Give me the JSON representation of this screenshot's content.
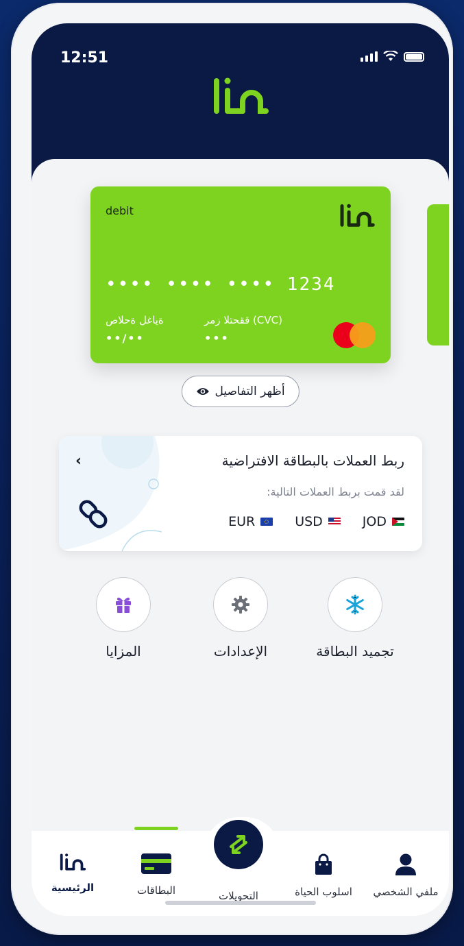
{
  "status": {
    "time": "12:51"
  },
  "brand": {
    "accent": "#7ed321",
    "navy": "#0b1a45"
  },
  "card": {
    "type": "debit",
    "masked_number": "•••• •••• •••• 1234",
    "expiry_label": "ةياغل ةحلاص",
    "expiry_value": "••/••",
    "cvc_label": "ققحتلا زمر (CVC)",
    "cvc_value": "•••",
    "network_icon": "mastercard-icon"
  },
  "show_details": {
    "label": "أظهر التفاصيل",
    "icon": "eye-icon"
  },
  "currency_link": {
    "title": "ربط العملات بالبطاقة الافتراضية",
    "subtitle": "لقد قمت بربط العملات التالية:",
    "currencies": [
      {
        "code": "JOD",
        "flag": "jordan-flag-icon"
      },
      {
        "code": "USD",
        "flag": "us-flag-icon"
      },
      {
        "code": "EUR",
        "flag": "eu-flag-icon"
      }
    ]
  },
  "actions": [
    {
      "label": "تجميد البطاقة",
      "icon": "snowflake-icon"
    },
    {
      "label": "الإعدادات",
      "icon": "gear-icon"
    },
    {
      "label": "المزايا",
      "icon": "gift-icon"
    }
  ],
  "nav": {
    "items": [
      {
        "label": "الرئيسية",
        "icon": "logo-icon",
        "active": true
      },
      {
        "label": "البطاقات",
        "icon": "card-icon"
      },
      {
        "label": "التحويلات",
        "icon": "transfer-icon"
      },
      {
        "label": "اسلوب الحياة",
        "icon": "shopping-bag-icon"
      },
      {
        "label": "ملفي الشخصي",
        "icon": "profile-icon"
      }
    ]
  }
}
